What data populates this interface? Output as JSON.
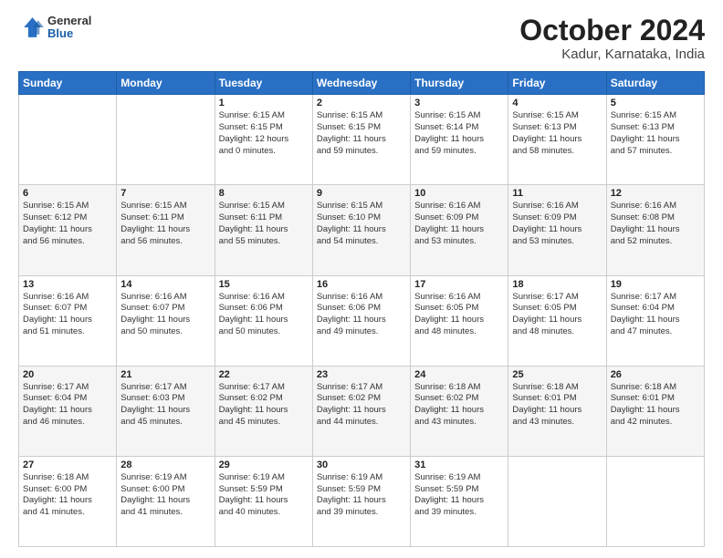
{
  "logo": {
    "general": "General",
    "blue": "Blue"
  },
  "header": {
    "title": "October 2024",
    "subtitle": "Kadur, Karnataka, India"
  },
  "weekdays": [
    "Sunday",
    "Monday",
    "Tuesday",
    "Wednesday",
    "Thursday",
    "Friday",
    "Saturday"
  ],
  "weeks": [
    [
      {
        "day": "",
        "info": ""
      },
      {
        "day": "",
        "info": ""
      },
      {
        "day": "1",
        "info": "Sunrise: 6:15 AM\nSunset: 6:15 PM\nDaylight: 12 hours\nand 0 minutes."
      },
      {
        "day": "2",
        "info": "Sunrise: 6:15 AM\nSunset: 6:15 PM\nDaylight: 11 hours\nand 59 minutes."
      },
      {
        "day": "3",
        "info": "Sunrise: 6:15 AM\nSunset: 6:14 PM\nDaylight: 11 hours\nand 59 minutes."
      },
      {
        "day": "4",
        "info": "Sunrise: 6:15 AM\nSunset: 6:13 PM\nDaylight: 11 hours\nand 58 minutes."
      },
      {
        "day": "5",
        "info": "Sunrise: 6:15 AM\nSunset: 6:13 PM\nDaylight: 11 hours\nand 57 minutes."
      }
    ],
    [
      {
        "day": "6",
        "info": "Sunrise: 6:15 AM\nSunset: 6:12 PM\nDaylight: 11 hours\nand 56 minutes."
      },
      {
        "day": "7",
        "info": "Sunrise: 6:15 AM\nSunset: 6:11 PM\nDaylight: 11 hours\nand 56 minutes."
      },
      {
        "day": "8",
        "info": "Sunrise: 6:15 AM\nSunset: 6:11 PM\nDaylight: 11 hours\nand 55 minutes."
      },
      {
        "day": "9",
        "info": "Sunrise: 6:15 AM\nSunset: 6:10 PM\nDaylight: 11 hours\nand 54 minutes."
      },
      {
        "day": "10",
        "info": "Sunrise: 6:16 AM\nSunset: 6:09 PM\nDaylight: 11 hours\nand 53 minutes."
      },
      {
        "day": "11",
        "info": "Sunrise: 6:16 AM\nSunset: 6:09 PM\nDaylight: 11 hours\nand 53 minutes."
      },
      {
        "day": "12",
        "info": "Sunrise: 6:16 AM\nSunset: 6:08 PM\nDaylight: 11 hours\nand 52 minutes."
      }
    ],
    [
      {
        "day": "13",
        "info": "Sunrise: 6:16 AM\nSunset: 6:07 PM\nDaylight: 11 hours\nand 51 minutes."
      },
      {
        "day": "14",
        "info": "Sunrise: 6:16 AM\nSunset: 6:07 PM\nDaylight: 11 hours\nand 50 minutes."
      },
      {
        "day": "15",
        "info": "Sunrise: 6:16 AM\nSunset: 6:06 PM\nDaylight: 11 hours\nand 50 minutes."
      },
      {
        "day": "16",
        "info": "Sunrise: 6:16 AM\nSunset: 6:06 PM\nDaylight: 11 hours\nand 49 minutes."
      },
      {
        "day": "17",
        "info": "Sunrise: 6:16 AM\nSunset: 6:05 PM\nDaylight: 11 hours\nand 48 minutes."
      },
      {
        "day": "18",
        "info": "Sunrise: 6:17 AM\nSunset: 6:05 PM\nDaylight: 11 hours\nand 48 minutes."
      },
      {
        "day": "19",
        "info": "Sunrise: 6:17 AM\nSunset: 6:04 PM\nDaylight: 11 hours\nand 47 minutes."
      }
    ],
    [
      {
        "day": "20",
        "info": "Sunrise: 6:17 AM\nSunset: 6:04 PM\nDaylight: 11 hours\nand 46 minutes."
      },
      {
        "day": "21",
        "info": "Sunrise: 6:17 AM\nSunset: 6:03 PM\nDaylight: 11 hours\nand 45 minutes."
      },
      {
        "day": "22",
        "info": "Sunrise: 6:17 AM\nSunset: 6:02 PM\nDaylight: 11 hours\nand 45 minutes."
      },
      {
        "day": "23",
        "info": "Sunrise: 6:17 AM\nSunset: 6:02 PM\nDaylight: 11 hours\nand 44 minutes."
      },
      {
        "day": "24",
        "info": "Sunrise: 6:18 AM\nSunset: 6:02 PM\nDaylight: 11 hours\nand 43 minutes."
      },
      {
        "day": "25",
        "info": "Sunrise: 6:18 AM\nSunset: 6:01 PM\nDaylight: 11 hours\nand 43 minutes."
      },
      {
        "day": "26",
        "info": "Sunrise: 6:18 AM\nSunset: 6:01 PM\nDaylight: 11 hours\nand 42 minutes."
      }
    ],
    [
      {
        "day": "27",
        "info": "Sunrise: 6:18 AM\nSunset: 6:00 PM\nDaylight: 11 hours\nand 41 minutes."
      },
      {
        "day": "28",
        "info": "Sunrise: 6:19 AM\nSunset: 6:00 PM\nDaylight: 11 hours\nand 41 minutes."
      },
      {
        "day": "29",
        "info": "Sunrise: 6:19 AM\nSunset: 5:59 PM\nDaylight: 11 hours\nand 40 minutes."
      },
      {
        "day": "30",
        "info": "Sunrise: 6:19 AM\nSunset: 5:59 PM\nDaylight: 11 hours\nand 39 minutes."
      },
      {
        "day": "31",
        "info": "Sunrise: 6:19 AM\nSunset: 5:59 PM\nDaylight: 11 hours\nand 39 minutes."
      },
      {
        "day": "",
        "info": ""
      },
      {
        "day": "",
        "info": ""
      }
    ]
  ]
}
